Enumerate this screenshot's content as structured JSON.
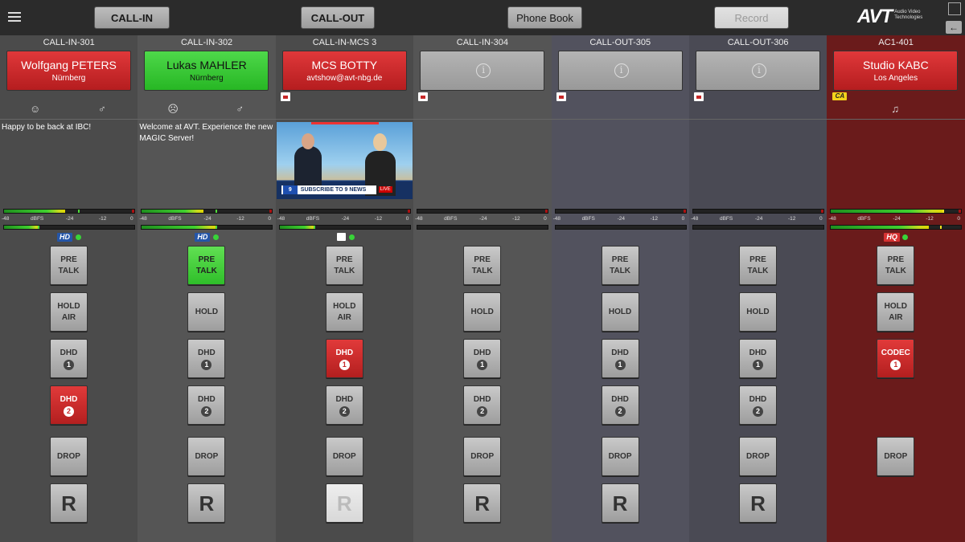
{
  "topbar": {
    "call_in_label": "CALL-IN",
    "call_out_label": "CALL-OUT",
    "phone_book_label": "Phone Book",
    "record_label": "Record",
    "logo_text": "AVT",
    "logo_sub": "Audio Video Technologies",
    "back_icon": "←"
  },
  "scale": [
    "-48",
    "dBFS",
    "-24",
    "-12",
    "0"
  ],
  "channels": [
    {
      "title": "CALL-IN-301",
      "caller_name": "Wolfgang PETERS",
      "caller_location": "Nürnberg",
      "caller_state": "red",
      "mood_icon": "smiley-icon",
      "mood_glyph": "☺",
      "gender_glyph": "♂",
      "message": "Happy to be back at IBC!",
      "codec": "HD",
      "meter_top": 0.47,
      "meter_bottom": 0.27,
      "pre_label": "PRE",
      "talk_label": "TALK",
      "hold_label": "HOLD",
      "air_label": "AIR",
      "dhd_label": "DHD",
      "dhd1_num": "1",
      "dhd2_num": "2",
      "drop_label": "DROP",
      "r_label": "R"
    },
    {
      "title": "CALL-IN-302",
      "caller_name": "Lukas MAHLER",
      "caller_location": "Nürnberg",
      "mood_glyph": "☹",
      "gender_glyph": "♂",
      "message": "Welcome at AVT. Experience the new MAGIC Server!",
      "codec": "HD",
      "meter_top": 0.47,
      "meter_bottom": 0.58,
      "pre_label": "PRE",
      "talk_label": "TALK",
      "hold_label": "HOLD",
      "dhd_label": "DHD",
      "dhd1_num": "1",
      "dhd2_num": "2",
      "drop_label": "DROP",
      "r_label": "R"
    },
    {
      "title": "CALL-IN-MCS 3",
      "caller_name": "MCS BOTTY",
      "caller_location": "avtshow@avt-nbg.de",
      "video_ticker": "SUBSCRIBE TO 9 NEWS",
      "video_live": "LIVE",
      "meter_top": 0.0,
      "meter_bottom": 0.27,
      "pre_label": "PRE",
      "talk_label": "TALK",
      "hold_label": "HOLD",
      "air_label": "AIR",
      "dhd_label": "DHD",
      "dhd1_num": "1",
      "dhd2_num": "2",
      "drop_label": "DROP",
      "r_label": "R"
    },
    {
      "title": "CALL-IN-304",
      "info_glyph": "i",
      "pre_label": "PRE",
      "talk_label": "TALK",
      "hold_label": "HOLD",
      "dhd_label": "DHD",
      "dhd1_num": "1",
      "dhd2_num": "2",
      "drop_label": "DROP",
      "r_label": "R"
    },
    {
      "title": "CALL-OUT-305",
      "info_glyph": "i",
      "pre_label": "PRE",
      "talk_label": "TALK",
      "hold_label": "HOLD",
      "dhd_label": "DHD",
      "dhd1_num": "1",
      "dhd2_num": "2",
      "drop_label": "DROP",
      "r_label": "R"
    },
    {
      "title": "CALL-OUT-306",
      "info_glyph": "i",
      "pre_label": "PRE",
      "talk_label": "TALK",
      "hold_label": "HOLD",
      "dhd_label": "DHD",
      "dhd1_num": "1",
      "dhd2_num": "2",
      "drop_label": "DROP",
      "r_label": "R"
    },
    {
      "title": "AC1-401",
      "caller_name": "Studio KABC",
      "caller_location": "Los Angeles",
      "badge": "CA",
      "music_glyph": "♫",
      "codec": "HQ",
      "meter_top": 0.86,
      "meter_bottom": 0.75,
      "pre_label": "PRE",
      "talk_label": "TALK",
      "hold_label": "HOLD",
      "air_label": "AIR",
      "codec_label": "CODEC",
      "codec_num": "1",
      "drop_label": "DROP"
    }
  ]
}
